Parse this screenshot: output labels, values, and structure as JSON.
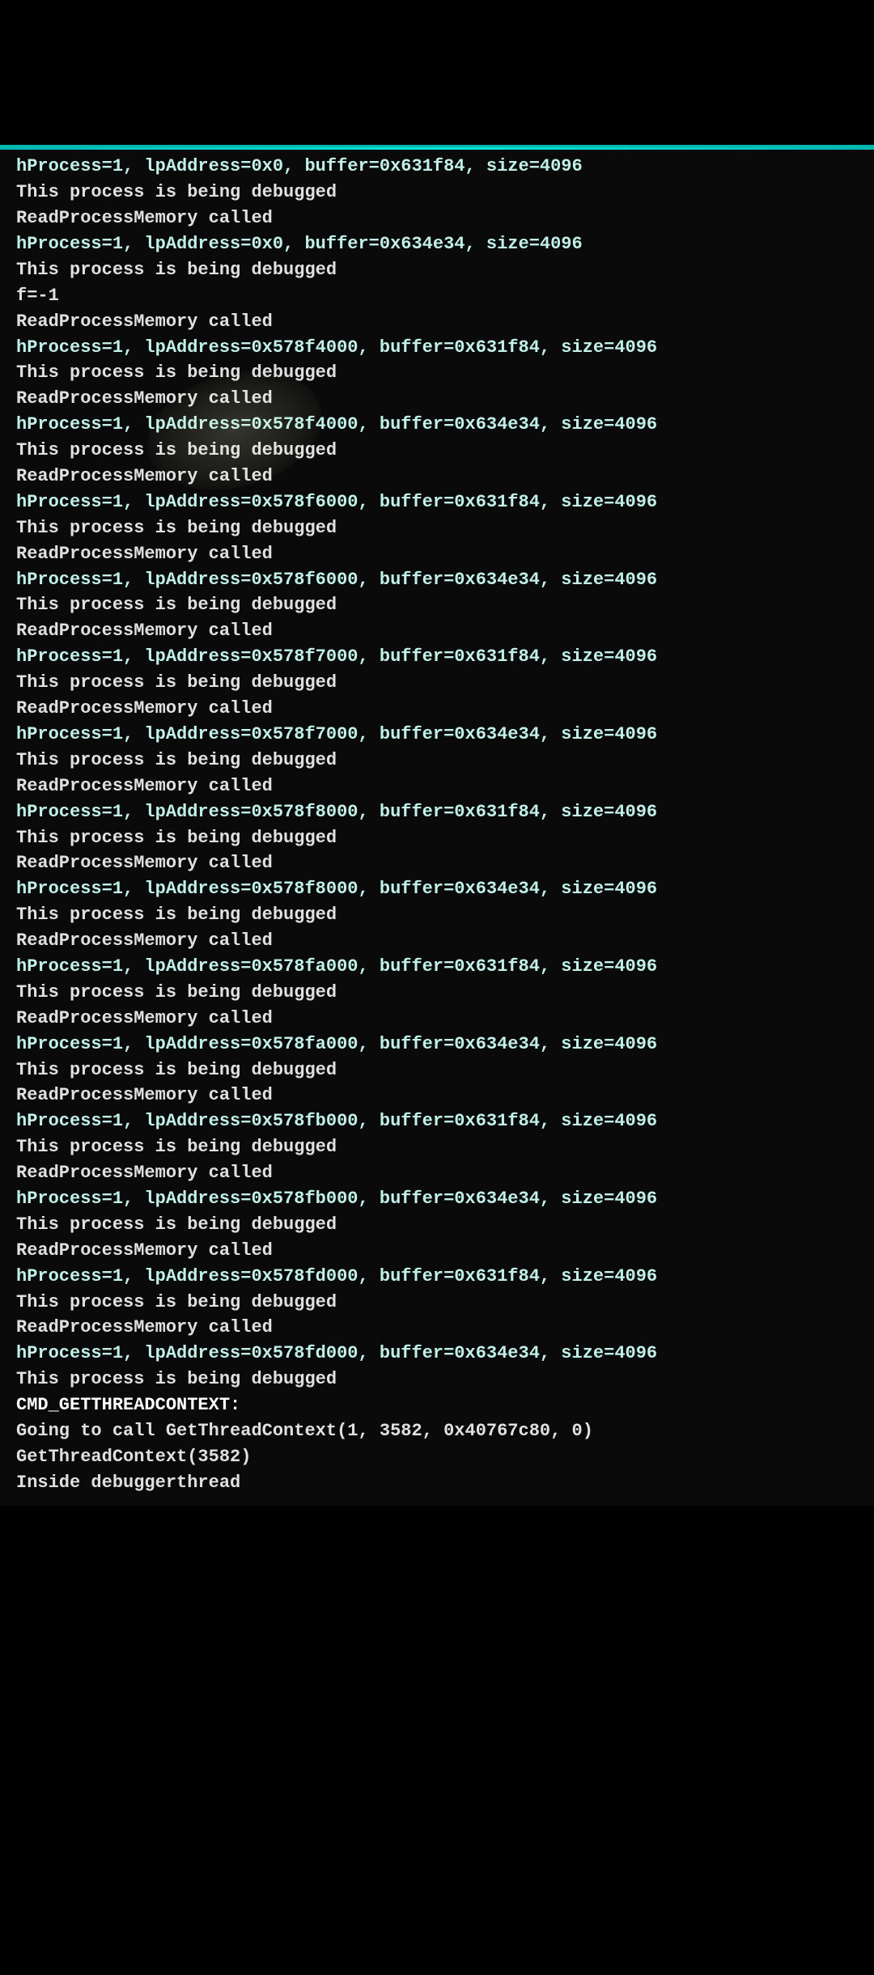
{
  "terminal": {
    "accent_color": "#00b8b0",
    "lines": [
      {
        "text": "hProcess=1, lpAddress=0x0, buffer=0x631f84, size=4096",
        "style": "line-cyan"
      },
      {
        "text": "This process is being debugged",
        "style": "line-white"
      },
      {
        "text": "ReadProcessMemory called",
        "style": "line-white"
      },
      {
        "text": "hProcess=1, lpAddress=0x0, buffer=0x634e34, size=4096",
        "style": "line-cyan"
      },
      {
        "text": "This process is being debugged",
        "style": "line-white"
      },
      {
        "text": "f=-1",
        "style": "line-white"
      },
      {
        "text": "ReadProcessMemory called",
        "style": "line-white"
      },
      {
        "text": "hProcess=1, lpAddress=0x578f4000, buffer=0x631f84, size=4096",
        "style": "line-cyan"
      },
      {
        "text": "This process is being debugged",
        "style": "line-white"
      },
      {
        "text": "ReadProcessMemory called",
        "style": "line-white"
      },
      {
        "text": "hProcess=1, lpAddress=0x578f4000, buffer=0x634e34, size=4096",
        "style": "line-cyan"
      },
      {
        "text": "This process is being debugged",
        "style": "line-white"
      },
      {
        "text": "ReadProcessMemory called",
        "style": "line-white"
      },
      {
        "text": "hProcess=1, lpAddress=0x578f6000, buffer=0x631f84, size=4096",
        "style": "line-cyan"
      },
      {
        "text": "This process is being debugged",
        "style": "line-white"
      },
      {
        "text": "ReadProcessMemory called",
        "style": "line-white"
      },
      {
        "text": "hProcess=1, lpAddress=0x578f6000, buffer=0x634e34, size=4096",
        "style": "line-cyan"
      },
      {
        "text": "This process is being debugged",
        "style": "line-white"
      },
      {
        "text": "ReadProcessMemory called",
        "style": "line-white"
      },
      {
        "text": "hProcess=1, lpAddress=0x578f7000, buffer=0x631f84, size=4096",
        "style": "line-cyan"
      },
      {
        "text": "This process is being debugged",
        "style": "line-white"
      },
      {
        "text": "ReadProcessMemory called",
        "style": "line-white"
      },
      {
        "text": "hProcess=1, lpAddress=0x578f7000, buffer=0x634e34, size=4096",
        "style": "line-cyan"
      },
      {
        "text": "This process is being debugged",
        "style": "line-white"
      },
      {
        "text": "ReadProcessMemory called",
        "style": "line-white"
      },
      {
        "text": "hProcess=1, lpAddress=0x578f8000, buffer=0x631f84, size=4096",
        "style": "line-cyan"
      },
      {
        "text": "This process is being debugged",
        "style": "line-white"
      },
      {
        "text": "ReadProcessMemory called",
        "style": "line-white"
      },
      {
        "text": "hProcess=1, lpAddress=0x578f8000, buffer=0x634e34, size=4096",
        "style": "line-cyan"
      },
      {
        "text": "This process is being debugged",
        "style": "line-white"
      },
      {
        "text": "ReadProcessMemory called",
        "style": "line-white"
      },
      {
        "text": "hProcess=1, lpAddress=0x578fa000, buffer=0x631f84, size=4096",
        "style": "line-cyan"
      },
      {
        "text": "This process is being debugged",
        "style": "line-white"
      },
      {
        "text": "ReadProcessMemory called",
        "style": "line-white"
      },
      {
        "text": "hProcess=1, lpAddress=0x578fa000, buffer=0x634e34, size=4096",
        "style": "line-cyan"
      },
      {
        "text": "This process is being debugged",
        "style": "line-white"
      },
      {
        "text": "ReadProcessMemory called",
        "style": "line-white"
      },
      {
        "text": "hProcess=1, lpAddress=0x578fb000, buffer=0x631f84, size=4096",
        "style": "line-cyan"
      },
      {
        "text": "This process is being debugged",
        "style": "line-white"
      },
      {
        "text": "ReadProcessMemory called",
        "style": "line-white"
      },
      {
        "text": "hProcess=1, lpAddress=0x578fb000, buffer=0x634e34, size=4096",
        "style": "line-cyan"
      },
      {
        "text": "This process is being debugged",
        "style": "line-white"
      },
      {
        "text": "ReadProcessMemory called",
        "style": "line-white"
      },
      {
        "text": "hProcess=1, lpAddress=0x578fd000, buffer=0x631f84, size=4096",
        "style": "line-cyan"
      },
      {
        "text": "This process is being debugged",
        "style": "line-white"
      },
      {
        "text": "ReadProcessMemory called",
        "style": "line-white"
      },
      {
        "text": "hProcess=1, lpAddress=0x578fd000, buffer=0x634e34, size=4096",
        "style": "line-cyan"
      },
      {
        "text": "This process is being debugged",
        "style": "line-white"
      },
      {
        "text": "CMD_GETTHREADCONTEXT:",
        "style": "line-highlight"
      },
      {
        "text": "Going to call GetThreadContext(1, 3582, 0x40767c80, 0)",
        "style": "line-white"
      },
      {
        "text": "GetThreadContext(3582)",
        "style": "line-white"
      },
      {
        "text": "Inside debuggerthread",
        "style": "line-white"
      }
    ]
  }
}
